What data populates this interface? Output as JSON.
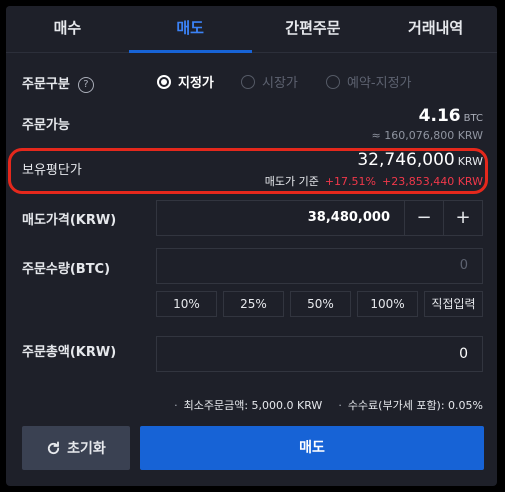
{
  "tabs": [
    {
      "label": "매수",
      "active": false
    },
    {
      "label": "매도",
      "active": true
    },
    {
      "label": "간편주문",
      "active": false
    },
    {
      "label": "거래내역",
      "active": false
    }
  ],
  "order_type": {
    "label": "주문구분",
    "help_icon": "?",
    "options": [
      {
        "label": "지정가",
        "selected": true
      },
      {
        "label": "시장가",
        "selected": false
      },
      {
        "label": "예약-지정가",
        "selected": false
      }
    ]
  },
  "available": {
    "label": "주문가능",
    "amount": "4.16",
    "unit": "BTC",
    "approx": "≈ 160,076,800",
    "approx_unit": "KRW"
  },
  "avg_buy_price": {
    "label": "보유평단가",
    "value": "32,746,000",
    "unit": "KRW",
    "basis": "매도가 기준",
    "rate": "+17.51%",
    "diff": "+23,853,440 KRW",
    "highlight_color": "#e5281c"
  },
  "sell_price": {
    "label": "매도가격(KRW)",
    "value": "38,480,000",
    "minus": "−",
    "plus": "+"
  },
  "quantity": {
    "label": "주문수량(BTC)",
    "placeholder": "0",
    "percent_buttons": [
      "10%",
      "25%",
      "50%",
      "100%",
      "직접입력"
    ]
  },
  "total": {
    "label": "주문총액(KRW)",
    "value": "0"
  },
  "fees": {
    "min_order": "최소주문금액: 5,000.0 KRW",
    "fee": "수수료(부가세 포함): 0.05%"
  },
  "buttons": {
    "reset": "초기화",
    "reset_icon": "refresh-icon",
    "sell": "매도"
  },
  "colors": {
    "background": "#1e2029",
    "accent": "#1763d6",
    "negative": "#f0384a"
  }
}
